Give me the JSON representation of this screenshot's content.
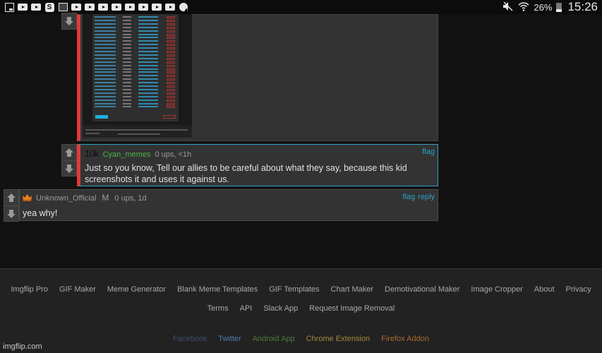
{
  "status_bar": {
    "left_icons": [
      "image-icon",
      "youtube-icon",
      "youtube-icon",
      "shazam-icon",
      "gmail-icon",
      "youtube-icon",
      "youtube-icon",
      "youtube-icon",
      "youtube-icon",
      "youtube-icon",
      "youtube-icon",
      "youtube-icon",
      "youtube-icon",
      "settings-alert-icon"
    ],
    "mute_icon": "🔇",
    "wifi_icon": "📶",
    "battery_percent": "26%",
    "time": "15:26"
  },
  "comments": [
    {
      "id": "image-comment",
      "type": "image",
      "image_alt": "screenshot of moderation list"
    },
    {
      "id": "cyan-comment",
      "points": "10k",
      "username": "Cyan_memes",
      "meta": "0 ups, <1h",
      "actions": [
        "flag"
      ],
      "text": "Just so you know, Tell our allies to be careful about what they say, because this kid screenshots it and uses it against us."
    },
    {
      "id": "unknown-comment",
      "badge": "crown",
      "username": "Unknown_Official",
      "mod_tag": "M",
      "meta": "0 ups, 1d",
      "actions": [
        "flag",
        "reply"
      ],
      "text": "yea why!"
    }
  ],
  "vote": {
    "up": "🡅",
    "down": "🡇"
  },
  "footer": {
    "row1": [
      "Imgflip Pro",
      "GIF Maker",
      "Meme Generator",
      "Blank Meme Templates",
      "GIF Templates",
      "Chart Maker",
      "Demotivational Maker",
      "Image Cropper",
      "About",
      "Privacy"
    ],
    "row2": [
      "Terms",
      "API",
      "Slack App",
      "Request Image Removal"
    ],
    "social": {
      "facebook": "Facebook",
      "twitter": "Twitter",
      "android": "Android App",
      "chrome": "Chrome Extension",
      "firefox": "Firefox Addon"
    },
    "domain": "imgflip.com"
  },
  "colors": {
    "accent_link": "#2aa2c4",
    "user_green": "#4ab34a",
    "flag_bar_red": "#e03a3a"
  }
}
